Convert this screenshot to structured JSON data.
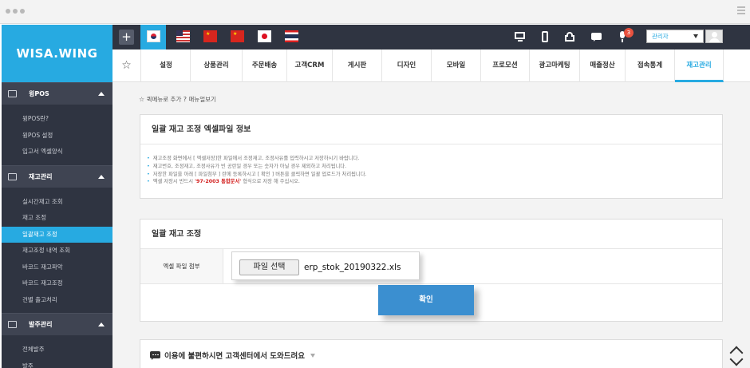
{
  "sidebar": {
    "logo": "WISA.WING",
    "sections": [
      {
        "title": "윙POS",
        "items": [
          "윙POS란?",
          "윙POS 설정",
          "입고서 엑셀양식"
        ]
      },
      {
        "title": "재고관리",
        "items": [
          "실시간재고 조회",
          "재고 조정",
          "일괄재고 조정",
          "재고조정 내역 조회",
          "바코드 재고파악",
          "바코드 재고조정",
          "건별 출고처리"
        ]
      },
      {
        "title": "발주관리",
        "items": [
          "전체발주",
          "발주"
        ]
      }
    ],
    "active_item": "일괄재고 조정"
  },
  "topbar": {
    "plus_label": "+",
    "flags": [
      "flag-kr-icon",
      "flag-us-icon",
      "flag-cn-icon",
      "flag-cn-icon",
      "flag-jp-icon",
      "flag-th-icon"
    ],
    "icons": [
      "monitor-icon",
      "mobile-icon",
      "basket-icon",
      "chat-icon",
      "mic-icon"
    ],
    "badge_count": "3",
    "user_select": "관리자"
  },
  "nav": {
    "tabs": [
      "설정",
      "상품관리",
      "주문배송",
      "고객CRM",
      "게시판",
      "디자인",
      "모바일",
      "프로모션",
      "광고마케팅",
      "매출정산",
      "접속통계",
      "재고관리"
    ],
    "active": "재고관리"
  },
  "quick": {
    "add": "퀵메뉴로 추가",
    "manual": "매뉴얼보기"
  },
  "info_card": {
    "title": "일괄 재고 조정 엑셀파일 정보",
    "notes": [
      "재고조정 화면에서 [ 엑셀저장]한 파일에서 조정재고, 조정사유를 입력하시고 저장하시기 바랍니다.",
      "재고번호, 조정재고, 조정사유가 빈 공란일 경우 또는 숫자가 아닐 경우 제외하고 처리됩니다.",
      "저장한 파일을 아래 [ 파일첨부 ] 란에 등록하시고 [ 확인 ] 버튼을 클릭하면 일괄 업로드가 처리됩니다."
    ],
    "last_note": {
      "prefix": "엑셀 저장시 반드시 ",
      "highlight": "'97-2003 통합문서'",
      "suffix": " 형식으로 저장 해 주십시오."
    }
  },
  "upload_card": {
    "title": "일괄 재고 조정",
    "label": "엑셀 파일 첨부",
    "file_button": "파일 선택",
    "file_name": "erp_stok_20190322.xls",
    "confirm": "확인"
  },
  "help": {
    "text": "이용에 불편하시면 고객센터에서 도와드려요"
  },
  "colors": {
    "accent": "#27aae1",
    "dark": "#2f3441",
    "button": "#3b8fd0",
    "highlight": "#d3201f"
  }
}
